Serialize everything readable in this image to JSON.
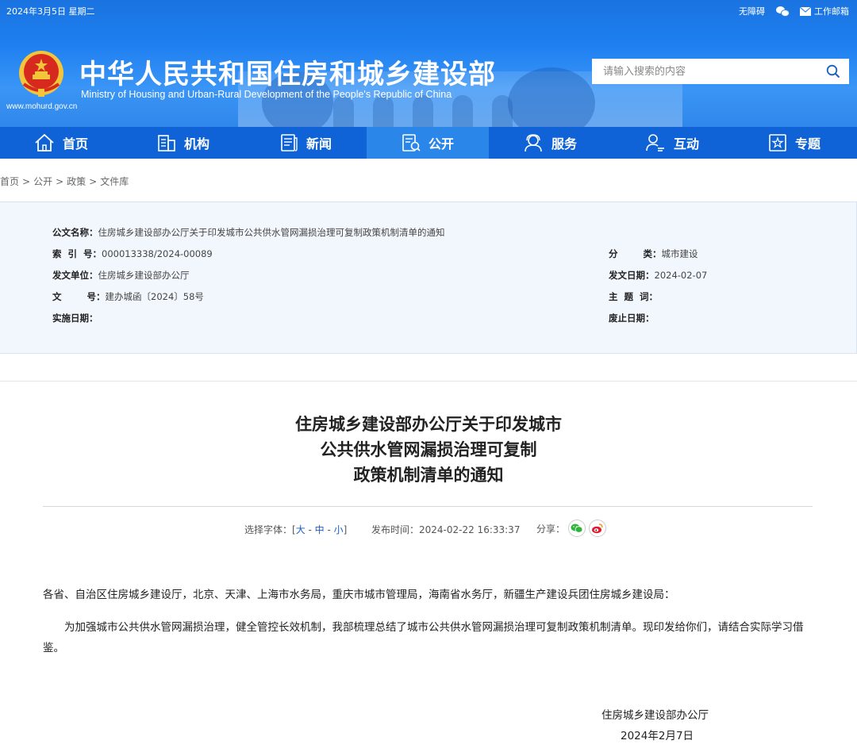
{
  "topbar": {
    "date": "2024年3月5日 星期二",
    "accessibility": "无障碍",
    "mail": "工作邮箱"
  },
  "header": {
    "title": "中华人民共和国住房和城乡建设部",
    "subtitle": "Ministry of Housing and Urban-Rural Development of the People's Republic of China",
    "url": "www.mohurd.gov.cn",
    "search_placeholder": "请输入搜索的内容"
  },
  "nav": [
    {
      "label": "首页",
      "icon": "home-icon"
    },
    {
      "label": "机构",
      "icon": "building-icon"
    },
    {
      "label": "新闻",
      "icon": "news-icon"
    },
    {
      "label": "公开",
      "icon": "document-icon",
      "active": true
    },
    {
      "label": "服务",
      "icon": "service-icon"
    },
    {
      "label": "互动",
      "icon": "user-interact-icon"
    },
    {
      "label": "专题",
      "icon": "star-icon"
    }
  ],
  "breadcrumb": [
    "首页",
    "公开",
    "政策",
    "文件库"
  ],
  "info": {
    "doc_name_label": "公文名称：",
    "doc_name": "住房城乡建设部办公厅关于印发城市公共供水管网漏损治理可复制政策机制清单的通知",
    "index_label": "索  引  号：",
    "index": "000013338/2024-00089",
    "issuer_label": "发文单位：",
    "issuer": "住房城乡建设部办公厅",
    "docno_label": "文        号：",
    "docno": "建办城函〔2024〕58号",
    "impl_label": "实施日期：",
    "impl": "",
    "category_label": "分        类：",
    "category": "城市建设",
    "issue_date_label": "发文日期：",
    "issue_date": "2024-02-07",
    "keywords_label": "主  题  词：",
    "keywords": "",
    "expiry_label": "废止日期：",
    "expiry": ""
  },
  "article": {
    "title_line1": "住房城乡建设部办公厅关于印发城市",
    "title_line2": "公共供水管网漏损治理可复制",
    "title_line3": "政策机制清单的通知",
    "font_label": "选择字体：[",
    "font_large": "大",
    "font_medium": "中",
    "font_small": "小",
    "font_close": "]",
    "publish_time": "发布时间：2024-02-22 16:33:37",
    "share_label": "分享：",
    "para1": "各省、自治区住房城乡建设厅，北京、天津、上海市水务局，重庆市城市管理局，海南省水务厅，新疆生产建设兵团住房城乡建设局：",
    "para2": "为加强城市公共供水管网漏损治理，健全管控长效机制，我部梳理总结了城市公共供水管网漏损治理可复制政策机制清单。现印发给你们，请结合实际学习借鉴。",
    "sign_org": "住房城乡建设部办公厅",
    "sign_date": "2024年2月7日"
  },
  "colors": {
    "header_blue": "#1e7ff0",
    "nav_blue": "#0f63d6",
    "nav_active": "#2b86ea",
    "info_bg": "#f2f7fd",
    "link_blue": "#1a5fc4",
    "emblem_red": "#d62a1e",
    "emblem_gold": "#f3c53a"
  }
}
